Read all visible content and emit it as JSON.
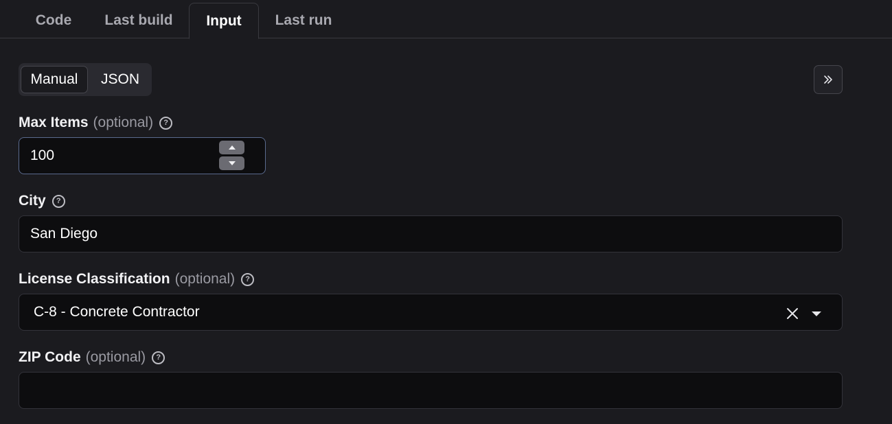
{
  "tabs": [
    {
      "label": "Code",
      "active": false
    },
    {
      "label": "Last build",
      "active": false
    },
    {
      "label": "Input",
      "active": true
    },
    {
      "label": "Last run",
      "active": false
    }
  ],
  "mode_toggle": {
    "manual_label": "Manual",
    "json_label": "JSON",
    "selected": "Manual"
  },
  "icons": {
    "expand": "double-chevron-right-icon",
    "help": "question-circle-icon",
    "clear": "close-icon",
    "dropdown": "caret-down-icon",
    "step_up": "caret-up-icon",
    "step_down": "caret-down-icon"
  },
  "help_glyph": "?",
  "fields": {
    "max_items": {
      "label": "Max Items",
      "optional_label": "(optional)",
      "value": "100"
    },
    "city": {
      "label": "City",
      "value": "San Diego"
    },
    "license": {
      "label": "License Classification",
      "optional_label": "(optional)",
      "value": "C-8 - Concrete Contractor"
    },
    "zip": {
      "label": "ZIP Code",
      "optional_label": "(optional)",
      "value": ""
    }
  },
  "colors": {
    "background": "#1b1b1f",
    "input_background": "#0d0d0f",
    "focus_border": "#5a6a8e"
  }
}
